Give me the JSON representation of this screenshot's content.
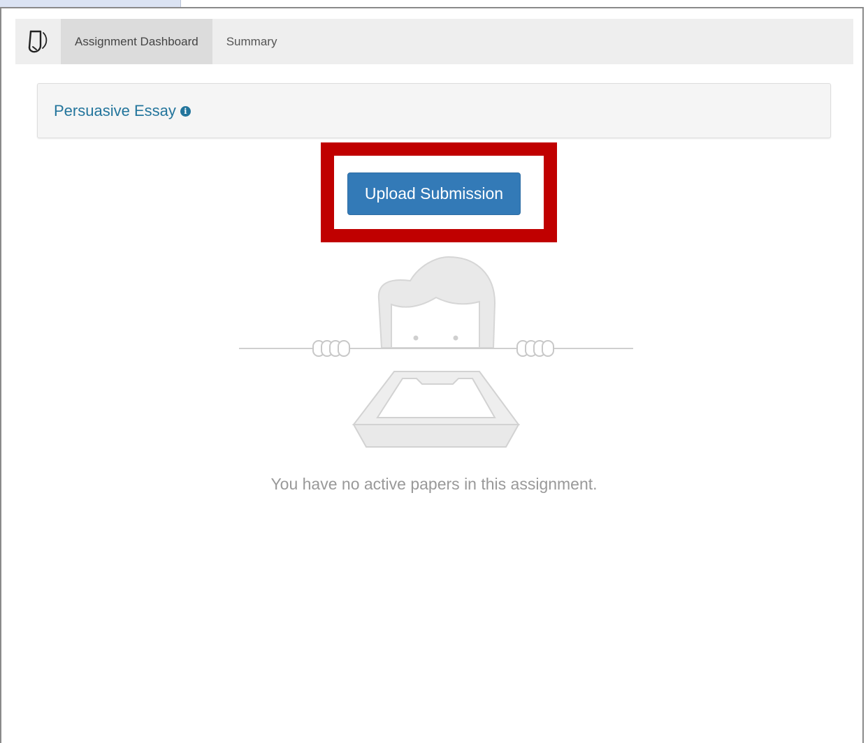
{
  "navbar": {
    "logo_icon": "turnitin-logo-icon",
    "tabs": [
      {
        "label": "Assignment Dashboard",
        "active": true
      },
      {
        "label": "Summary",
        "active": false
      }
    ]
  },
  "assignment": {
    "title": "Persuasive Essay",
    "info_icon": "info-icon"
  },
  "actions": {
    "upload_label": "Upload Submission"
  },
  "empty_state": {
    "illustration": "empty-inbox-person-illustration",
    "message": "You have no active papers in this assignment."
  },
  "colors": {
    "primary": "#337ab7",
    "link": "#23759c",
    "highlight": "#c00000",
    "navbar": "#eeeeee"
  }
}
